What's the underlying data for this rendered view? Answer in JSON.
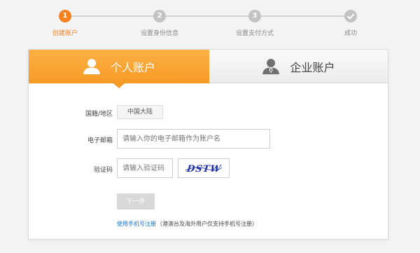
{
  "stepper": {
    "steps": [
      {
        "number": "1",
        "label": "创建账户"
      },
      {
        "number": "2",
        "label": "设置身份信息"
      },
      {
        "number": "3",
        "label": "设置支付方式"
      },
      {
        "number": "",
        "label": "成功"
      }
    ],
    "active_step": 1
  },
  "tabs": {
    "personal_label": "个人账户",
    "business_label": "企业账户",
    "active": "personal"
  },
  "form": {
    "region_label": "国籍/地区",
    "region_value": "中国大陆",
    "email_label": "电子邮箱",
    "email_placeholder": "请输入你的电子邮箱作为账户名",
    "captcha_label": "验证码",
    "captcha_placeholder": "请输入验证码",
    "captcha_text": "DSTW",
    "next_label": "下一步",
    "phone_link": "使用手机号注册",
    "phone_note": "（港澳台及海外用户仅支持手机号注册）"
  },
  "colors": {
    "accent": "#f5821f",
    "tab_active": "#f79a26",
    "link": "#1a73c8",
    "captcha_text": "#1f2fa8"
  }
}
